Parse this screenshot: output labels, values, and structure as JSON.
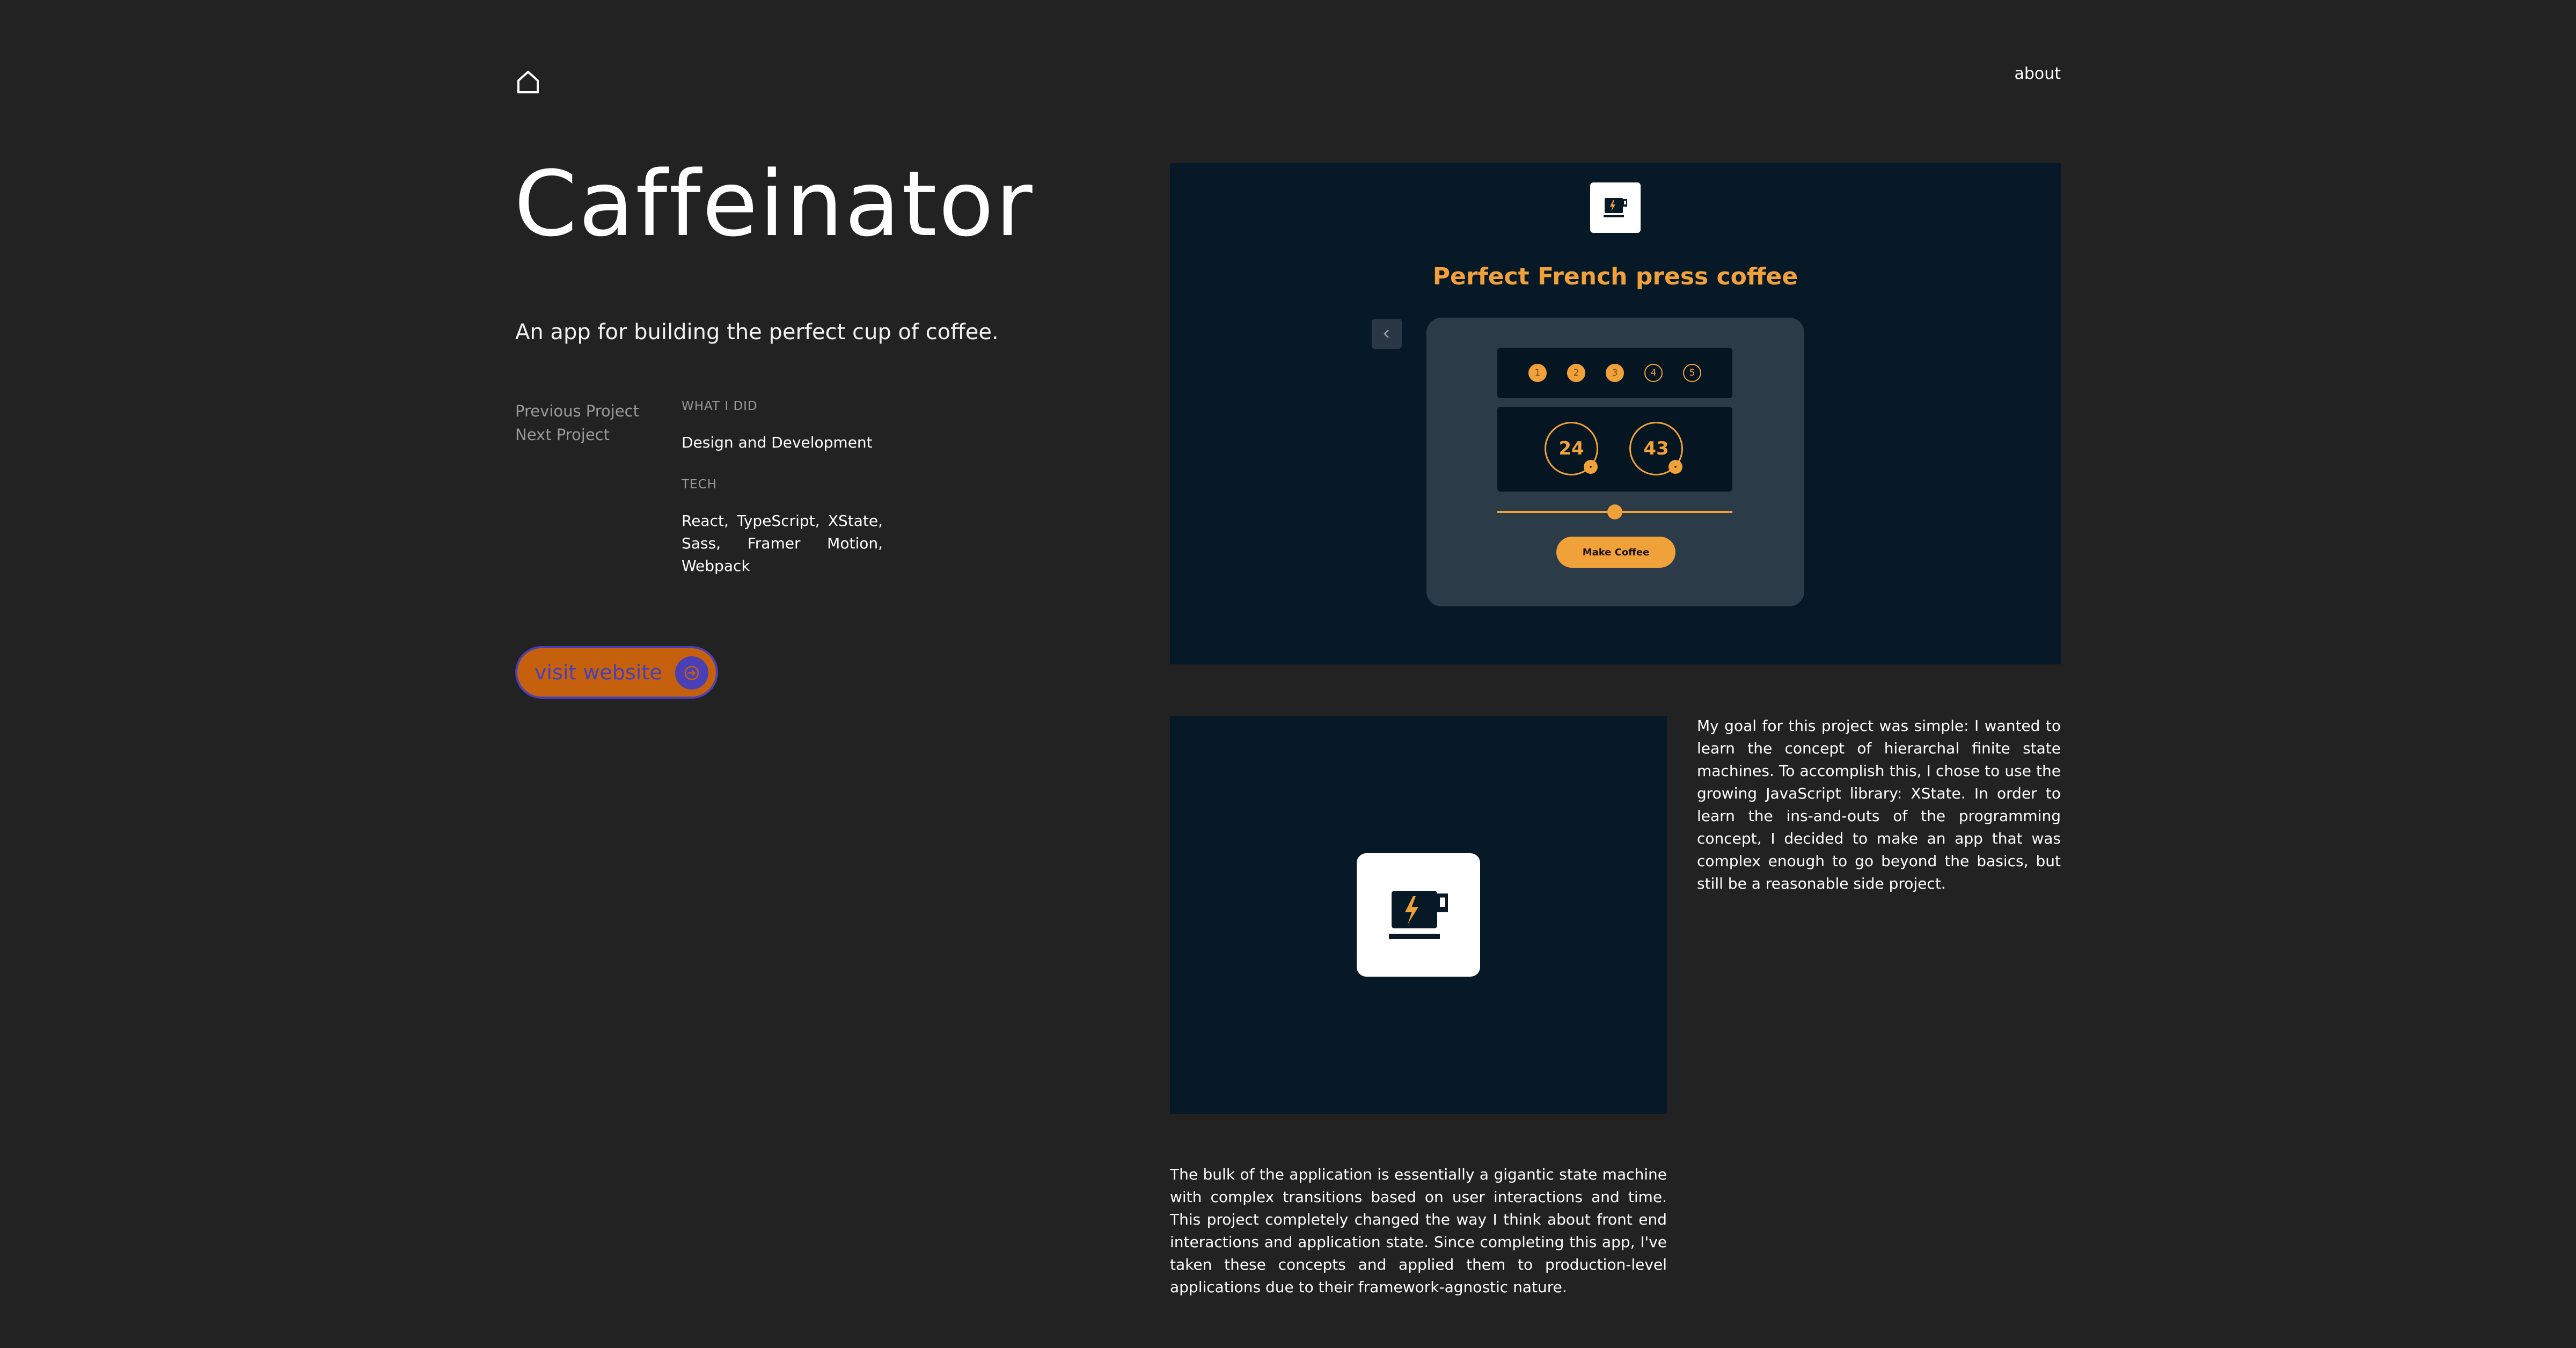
{
  "header": {
    "home_icon": "home-icon",
    "about_label": "about"
  },
  "project": {
    "title": "Caffeinator",
    "tagline": "An app for building the perfect cup of coffee.",
    "previous_label": "Previous Project",
    "next_label": "Next Project",
    "what_label": "WHAT I DID",
    "what_value": "Design and Development",
    "tech_label": "TECH",
    "tech_value": "React, TypeScript, XState, Sass, Framer Motion, Webpack",
    "visit_label": "visit website",
    "visit_icon": "arrow-right-icon"
  },
  "screenshot": {
    "app_title": "Perfect French press coffee",
    "steps": [
      "1",
      "2",
      "3",
      "4",
      "5"
    ],
    "completed_steps": 3,
    "dial_1_value": "24",
    "dial_2_value": "43",
    "slider_value": 0.5,
    "make_button_label": "Make Coffee"
  },
  "content": {
    "paragraph_1": "My goal for this project was simple: I wanted to learn the concept of hierarchal finite state machines. To accomplish this, I chose to use the growing JavaScript library: XState. In order to learn the ins-and-outs of the programming concept, I decided to make an app that was complex enough to go beyond the basics, but still be a reasonable side project.",
    "paragraph_2": "The bulk of the application is essentially a gigantic state machine with complex transitions based on user interactions and time. This project completely changed the way I think about front end interactions and application state. Since completing this app, I've taken these concepts and applied them to production-level applications due to their framework-agnostic nature."
  },
  "colors": {
    "page_background": "#222222",
    "panel_background": "#071827",
    "accent_orange": "#f0a13a",
    "button_orange": "#c5600d",
    "button_purple": "#4b3fb5"
  }
}
